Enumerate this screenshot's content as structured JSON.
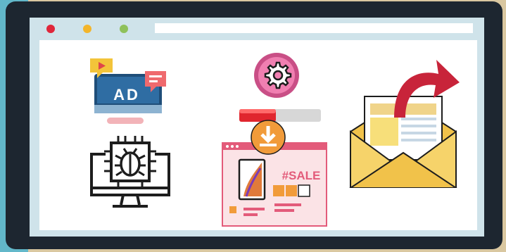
{
  "window": {
    "controls": [
      "close",
      "minimize",
      "maximize"
    ],
    "colors": {
      "close": "#e0263a",
      "minimize": "#f3b52a",
      "maximize": "#8fc15a"
    }
  },
  "icons": {
    "ad_monitor": {
      "label": "AD",
      "icon": "ad-monitor-icon"
    },
    "settings_progress": {
      "icon": "gear-progress-icon",
      "progress": 0.45
    },
    "email_send": {
      "icon": "open-envelope-share-icon"
    },
    "bug_monitor": {
      "icon": "bug-chip-monitor-icon"
    },
    "sale_page": {
      "label": "#SALE",
      "icon": "sale-webpage-download-icon"
    }
  }
}
